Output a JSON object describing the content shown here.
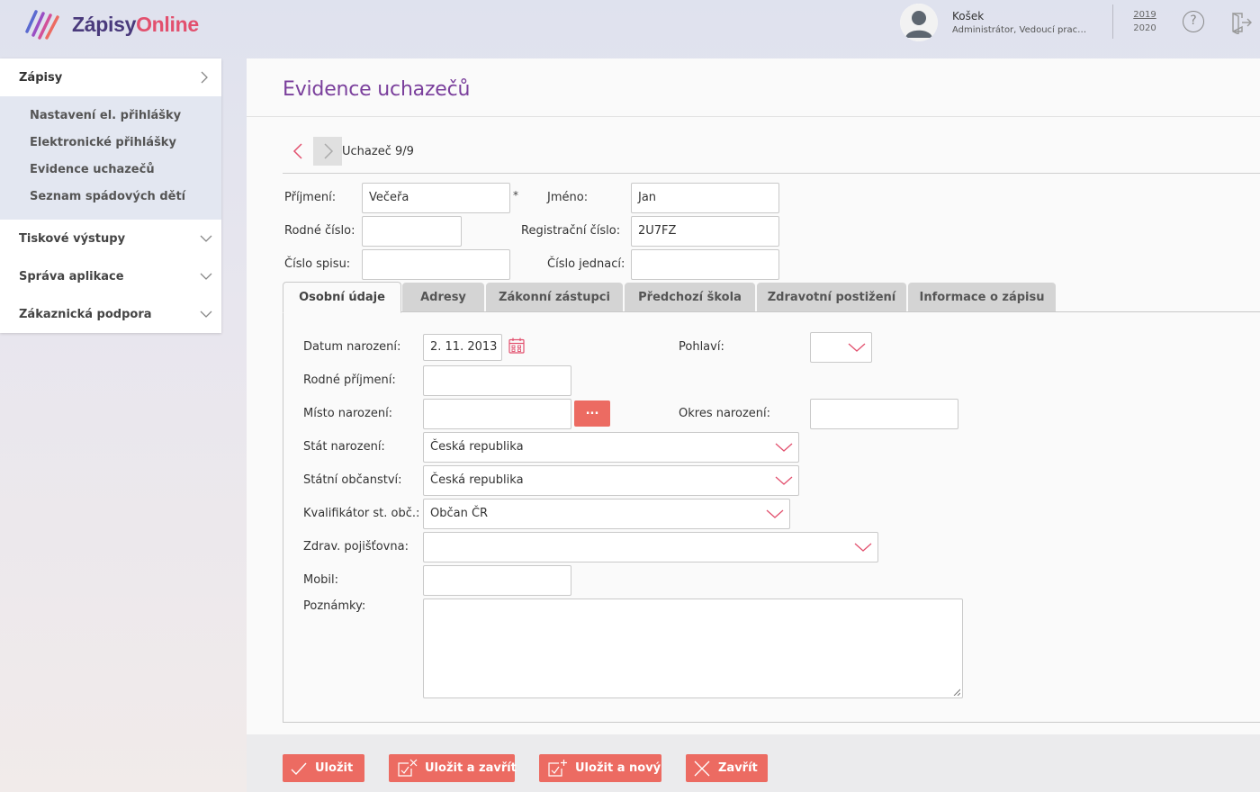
{
  "header": {
    "logo_part1": "Zápisy",
    "logo_part2": "Online",
    "user_name": "Košek",
    "user_role": "Administrátor, Vedoucí pracovník",
    "year_from": "2019",
    "year_to": "2020",
    "help_glyph": "?"
  },
  "sidebar": {
    "active_section": "Zápisy",
    "sub_items": [
      {
        "label": "Nastavení el. přihlášky"
      },
      {
        "label": "Elektronické přihlášky"
      },
      {
        "label": "Evidence uchazečů"
      },
      {
        "label": "Seznam spádových dětí"
      }
    ],
    "categories": [
      {
        "label": "Tiskové výstupy"
      },
      {
        "label": "Správa aplikace"
      },
      {
        "label": "Zákaznická podpora"
      }
    ]
  },
  "page": {
    "title": "Evidence uchazečů",
    "record_label": "Uchazeč 9/9"
  },
  "form": {
    "prijmeni_label": "Příjmení:",
    "prijmeni_value": "Večeřa",
    "required_mark": "*",
    "jmeno_label": "Jméno:",
    "jmeno_value": "Jan",
    "rodne_cislo_label": "Rodné číslo:",
    "rodne_cislo_value": "",
    "registracni_label": "Registrační číslo:",
    "registracni_value": "2U7FZ",
    "cislo_spisu_label": "Číslo spisu:",
    "cislo_spisu_value": "",
    "cislo_jednaci_label": "Číslo jednací:",
    "cislo_jednaci_value": ""
  },
  "tabs": [
    {
      "label": "Osobní údaje",
      "active": true
    },
    {
      "label": "Adresy"
    },
    {
      "label": "Zákonní zástupci"
    },
    {
      "label": "Předchozí škola"
    },
    {
      "label": "Zdravotní postižení"
    },
    {
      "label": "Informace o zápisu"
    }
  ],
  "personal": {
    "datum_label": "Datum narození:",
    "datum_value": "2. 11. 2013",
    "pohlavi_label": "Pohlaví:",
    "pohlavi_value": "",
    "rodne_prijmeni_label": "Rodné příjmení:",
    "rodne_prijmeni_value": "",
    "misto_label": "Místo narození:",
    "misto_value": "",
    "misto_button": "...",
    "okres_label": "Okres narození:",
    "okres_value": "",
    "stat_label": "Stát narození:",
    "stat_value": "Česká republika",
    "obcanstvi_label": "Státní občanství:",
    "obcanstvi_value": "Česká republika",
    "kvalifikator_label": "Kvalifikátor st. obč.:",
    "kvalifikator_value": "Občan ČR",
    "pojistovna_label": "Zdrav. pojišťovna:",
    "pojistovna_value": "",
    "mobil_label": "Mobil:",
    "mobil_value": "",
    "poznamky_label": "Poznámky:",
    "poznamky_value": ""
  },
  "footer": {
    "save": "Uložit",
    "save_close": "Uložit a zavřít",
    "save_new": "Uložit a nový",
    "close": "Zavřít"
  },
  "colors": {
    "accent": "#ec6b62",
    "title": "#7a3f9c",
    "logo_dark": "#4a3a7c",
    "logo_accent": "#e2506e"
  }
}
